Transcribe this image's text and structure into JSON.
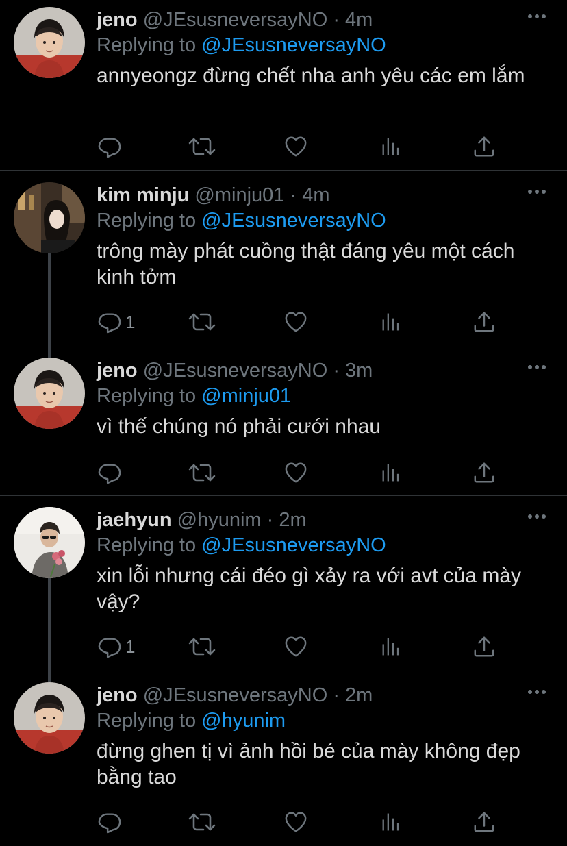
{
  "colors": {
    "background": "#000000",
    "text_primary": "#d9d9d9",
    "text_secondary": "#6e767d",
    "mention": "#1d9bf0",
    "separator": "#2f3336",
    "thread_line": "#3d4248"
  },
  "icons": {
    "reply": "reply-icon",
    "retweet": "retweet-icon",
    "like": "heart-icon",
    "analytics": "analytics-icon",
    "share": "share-icon",
    "more": "more-icon"
  },
  "tweets": [
    {
      "display_name": "jeno",
      "handle": "@JEsusneversayNO",
      "time": "· 4m",
      "replying_prefix": "Replying to",
      "replying_to": "@JEsusneversayNO",
      "text": "annyeongz đừng chết nha anh yêu các em lắm",
      "reply_count": ""
    },
    {
      "display_name": "kim minju",
      "handle": "@minju01",
      "time": "· 4m",
      "replying_prefix": "Replying to",
      "replying_to": "@JEsusneversayNO",
      "text": "trông mày phát cuồng thật đáng yêu một cách kinh tởm",
      "reply_count": "1"
    },
    {
      "display_name": "jeno",
      "handle": "@JEsusneversayNO",
      "time": "· 3m",
      "replying_prefix": "Replying to",
      "replying_to": "@minju01",
      "text": "vì thế chúng nó phải cưới nhau",
      "reply_count": ""
    },
    {
      "display_name": "jaehyun",
      "handle": "@hyunim",
      "time": "· 2m",
      "replying_prefix": "Replying to",
      "replying_to": "@JEsusneversayNO",
      "text": "xin lỗi nhưng cái đéo gì xảy ra với avt của mày vậy?",
      "reply_count": "1"
    },
    {
      "display_name": "jeno",
      "handle": "@JEsusneversayNO",
      "time": "· 2m",
      "replying_prefix": "Replying to",
      "replying_to": "@hyunim",
      "text": "đừng ghen tị vì ảnh hồi bé của mày không đẹp bằng tao",
      "reply_count": ""
    }
  ]
}
